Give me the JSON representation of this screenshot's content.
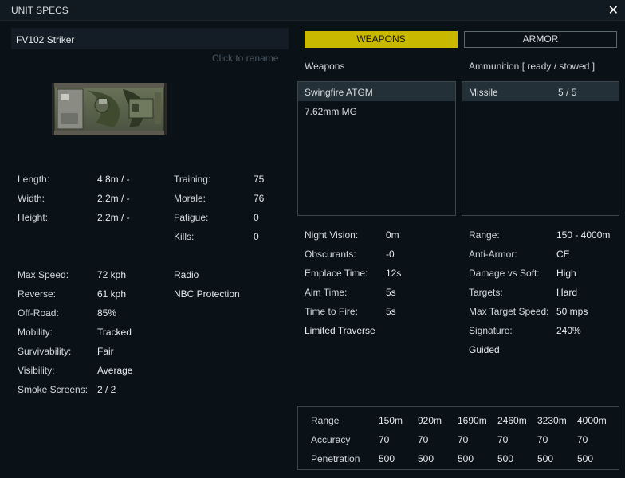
{
  "window": {
    "title": "UNIT SPECS",
    "close_glyph": "✕"
  },
  "unit": {
    "name": "FV102 Striker",
    "rename_hint": "Click to rename"
  },
  "dimensions": [
    {
      "label": "Length:",
      "value": "4.8m / -"
    },
    {
      "label": "Width:",
      "value": "2.2m / -"
    },
    {
      "label": "Height:",
      "value": "2.2m / -"
    }
  ],
  "crew": [
    {
      "label": "Training:",
      "value": "75"
    },
    {
      "label": "Morale:",
      "value": "76"
    },
    {
      "label": "Fatigue:",
      "value": "0"
    },
    {
      "label": "Kills:",
      "value": "0"
    }
  ],
  "mobility": [
    {
      "label": "Max Speed:",
      "value": "72 kph"
    },
    {
      "label": "Reverse:",
      "value": "61 kph"
    },
    {
      "label": "Off-Road:",
      "value": "85%"
    },
    {
      "label": "Mobility:",
      "value": "Tracked"
    },
    {
      "label": "Survivability:",
      "value": "Fair"
    },
    {
      "label": "Visibility:",
      "value": "Average"
    },
    {
      "label": "Smoke Screens:",
      "value": "2 / 2"
    }
  ],
  "features": [
    "Radio",
    "NBC Protection"
  ],
  "tabs": {
    "weapons": "WEAPONS",
    "armor": "ARMOR"
  },
  "weapons_header": "Weapons",
  "ammo_header": "Ammunition [ ready / stowed ]",
  "weapons": [
    "Swingfire ATGM",
    "7.62mm MG"
  ],
  "ammunition": [
    {
      "name": "Missile",
      "count": "5 / 5"
    }
  ],
  "weapon_stats": [
    {
      "label": "Night Vision:",
      "value": "0m"
    },
    {
      "label": "Obscurants:",
      "value": "-0"
    },
    {
      "label": "Emplace Time:",
      "value": "12s"
    },
    {
      "label": "Aim Time:",
      "value": "5s"
    },
    {
      "label": "Time to Fire:",
      "value": "5s"
    }
  ],
  "weapon_note": "Limited Traverse",
  "ammo_stats": [
    {
      "label": "Range:",
      "value": "150 - 4000m"
    },
    {
      "label": "Anti-Armor:",
      "value": "CE"
    },
    {
      "label": "Damage vs Soft:",
      "value": "High"
    },
    {
      "label": "Targets:",
      "value": "Hard"
    },
    {
      "label": "Max Target Speed:",
      "value": "50 mps"
    },
    {
      "label": "Signature:",
      "value": "240%"
    }
  ],
  "ammo_note": "Guided",
  "range_table": {
    "rows": [
      {
        "label": "Range",
        "values": [
          "150m",
          "920m",
          "1690m",
          "2460m",
          "3230m",
          "4000m"
        ]
      },
      {
        "label": "Accuracy",
        "values": [
          "70",
          "70",
          "70",
          "70",
          "70",
          "70"
        ]
      },
      {
        "label": "Penetration",
        "values": [
          "500",
          "500",
          "500",
          "500",
          "500",
          "500"
        ]
      }
    ]
  }
}
